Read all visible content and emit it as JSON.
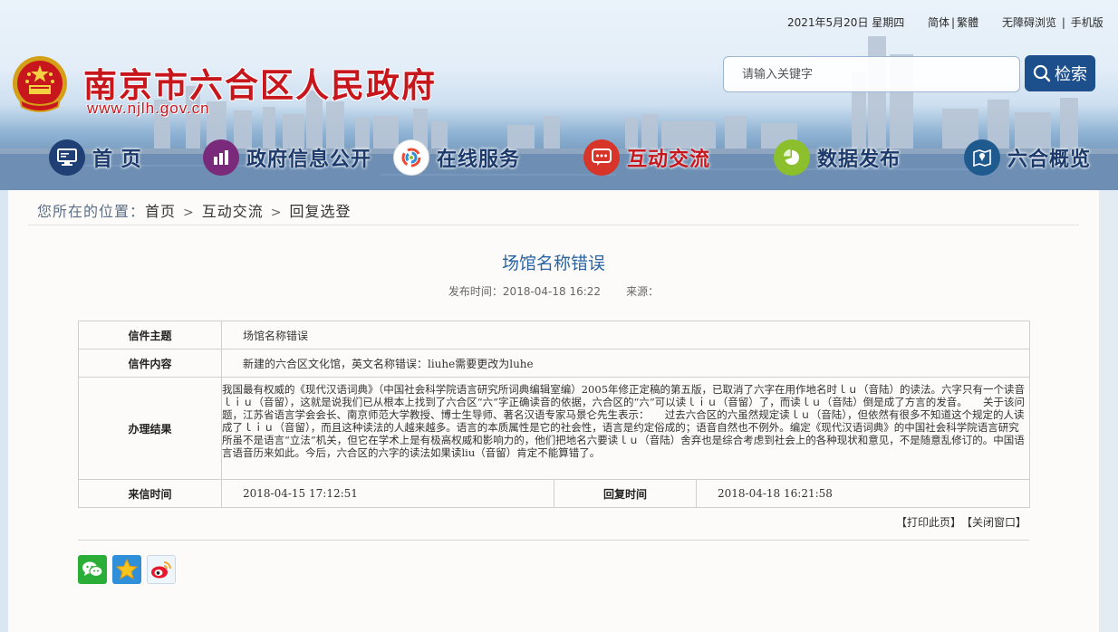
{
  "topbar": {
    "date": "2021年5月20日  星期四",
    "lang_simplified": "简体",
    "lang_separator": "|",
    "lang_traditional": "繁體",
    "accessibility": "无障碍浏览",
    "link_separator": "|",
    "mobile": "手机版"
  },
  "site": {
    "title": "南京市六合区人民政府",
    "domain": "www.njlh.gov.cn",
    "title_color": "#c8161d"
  },
  "search": {
    "placeholder": "请输入关键字",
    "button_label": "检索"
  },
  "nav": {
    "items": [
      {
        "label": "首 页",
        "icon": "monitor-icon",
        "color": "#1f3f75"
      },
      {
        "label": "政府信息公开",
        "icon": "document-chart-icon",
        "color": "#7a2a7a"
      },
      {
        "label": "在线服务",
        "icon": "service-circle-icon",
        "color": "#ffffff"
      },
      {
        "label": "互动交流",
        "icon": "chat-bubble-icon",
        "color": "#d8352a"
      },
      {
        "label": "数据发布",
        "icon": "pie-chart-icon",
        "color": "#8bbf2c"
      },
      {
        "label": "六合概览",
        "icon": "map-pin-icon",
        "color": "#1f5a8f"
      }
    ],
    "active": "互动交流"
  },
  "breadcrumb": {
    "prefix": "您所在的位置：",
    "items": [
      "首页",
      "互动交流",
      "回复选登"
    ],
    "separator": ">"
  },
  "article": {
    "title": "场馆名称错误",
    "publish_label": "发布时间：",
    "publish_time": "2018-04-18 16:22",
    "source_label": "来源："
  },
  "letter": {
    "subject_label": "信件主题",
    "subject": "场馆名称错误",
    "content_label": "信件内容",
    "content": "新建的六合区文化馆，英文名称错误：liuhe需要更改为luhe",
    "result_label": "办理结果",
    "result": "我国最有权威的《现代汉语词典》（中国社会科学院语言研究所词典编辑室编）2005年修正定稿的第五版，已取消了六字在用作地名时ｌｕ（音陆）的读法。六字只有一个读音ｌｉｕ（音留），这就是说我们已从根本上找到了六合区“六”字正确读音的依据，六合区的“六”可以读ｌｉｕ（音留）了，而读ｌｕ（音陆）倒是成了方言的发音。　　关于该问题，江苏省语言学会会长、南京师范大学教授、博士生导师、著名汉语专家马景仑先生表示：　　过去六合区的六虽然规定读ｌｕ（音陆），但依然有很多不知道这个规定的人读成了ｌｉｕ（音留），而且这种读法的人越来越多。语言的本质属性是它的社会性，语言是约定俗成的；语音自然也不例外。编定《现代汉语词典》的中国社会科学院语言研究所虽不是语言“立法”机关，但它在学术上是有极高权威和影响力的，他们把地名六要读ｌｕ（音陆）舍弃也是综合考虑到社会上的各种现状和意见，不是随意乱修订的。中国语言语音历来如此。今后，六合区的六字的读法如果读liu（音留）肯定不能算错了。",
    "received_label": "来信时间",
    "received_time": "2018-04-15 17:12:51",
    "reply_label": "回复时间",
    "reply_time": "2018-04-18 16:21:58"
  },
  "page_actions": {
    "print": "【打印此页】",
    "close": "【关闭窗口】"
  },
  "share": [
    {
      "icon": "wechat-icon",
      "color": "#2aae37"
    },
    {
      "icon": "star-favorite-icon",
      "color": "#2f8fd8"
    },
    {
      "icon": "weibo-icon",
      "color": "#5aaee6"
    }
  ]
}
